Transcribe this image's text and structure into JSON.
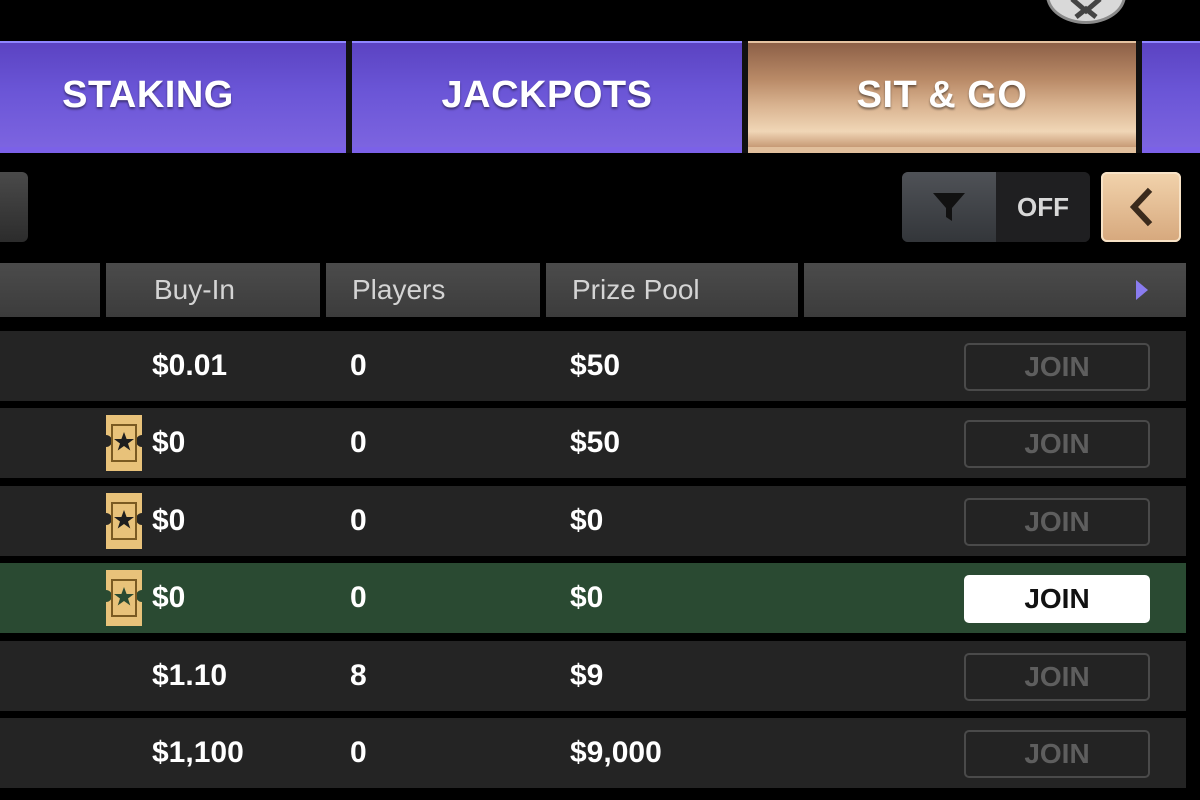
{
  "tabs": [
    {
      "label": "STAKING"
    },
    {
      "label": "JACKPOTS"
    },
    {
      "label": "SIT & GO"
    }
  ],
  "filter": {
    "state": "OFF"
  },
  "columns": {
    "buy_in": "Buy-In",
    "players": "Players",
    "prize_pool": "Prize Pool"
  },
  "rows": [
    {
      "buy_in": "$0.01",
      "players": "0",
      "prize_pool": "$50",
      "join": "JOIN"
    },
    {
      "buy_in": "$0",
      "players": "0",
      "prize_pool": "$50",
      "join": "JOIN"
    },
    {
      "buy_in": "$0",
      "players": "0",
      "prize_pool": "$0",
      "join": "JOIN"
    },
    {
      "buy_in": "$0",
      "players": "0",
      "prize_pool": "$0",
      "join": "JOIN"
    },
    {
      "buy_in": "$1.10",
      "players": "8",
      "prize_pool": "$9",
      "join": "JOIN"
    },
    {
      "buy_in": "$1,100",
      "players": "0",
      "prize_pool": "$9,000",
      "join": "JOIN"
    }
  ],
  "colors": {
    "tab_purple": "#6a55d6",
    "tab_active": "#d9b390",
    "row_bg": "#242424",
    "row_highlight": "#2a4a32",
    "ticket_gold": "#e8c27a"
  }
}
